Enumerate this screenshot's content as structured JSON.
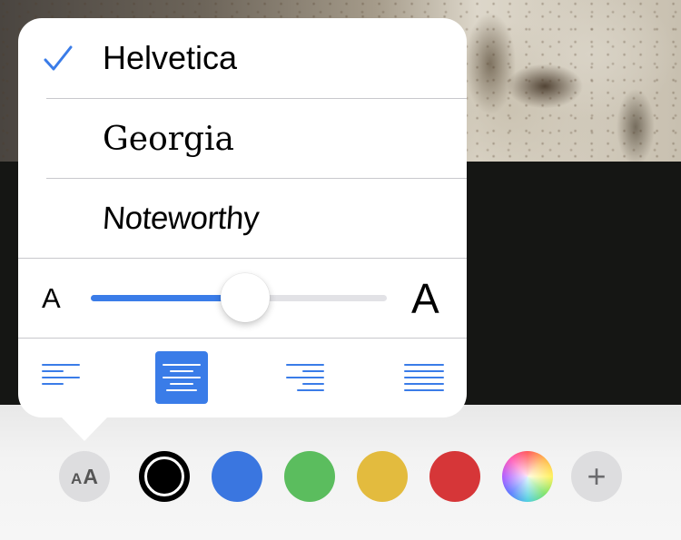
{
  "fonts": {
    "options": [
      {
        "label": "Helvetica",
        "selected": true
      },
      {
        "label": "Georgia",
        "selected": false
      },
      {
        "label": "Noteworthy",
        "selected": false
      }
    ]
  },
  "size_control": {
    "small_label": "A",
    "large_label": "A",
    "value_fraction": 0.52
  },
  "alignment": {
    "options": [
      "left-align-icon",
      "center-align-icon",
      "right-align-icon",
      "justify-icon"
    ],
    "selected": "center"
  },
  "toolbar": {
    "font_button": {
      "small": "A",
      "big": "A"
    },
    "colors": [
      "#000000",
      "#3a76e0",
      "#5bbd5e",
      "#e3bb3e",
      "#d63638"
    ],
    "plus_label": "+"
  },
  "accent_color": "#3a7ce8"
}
